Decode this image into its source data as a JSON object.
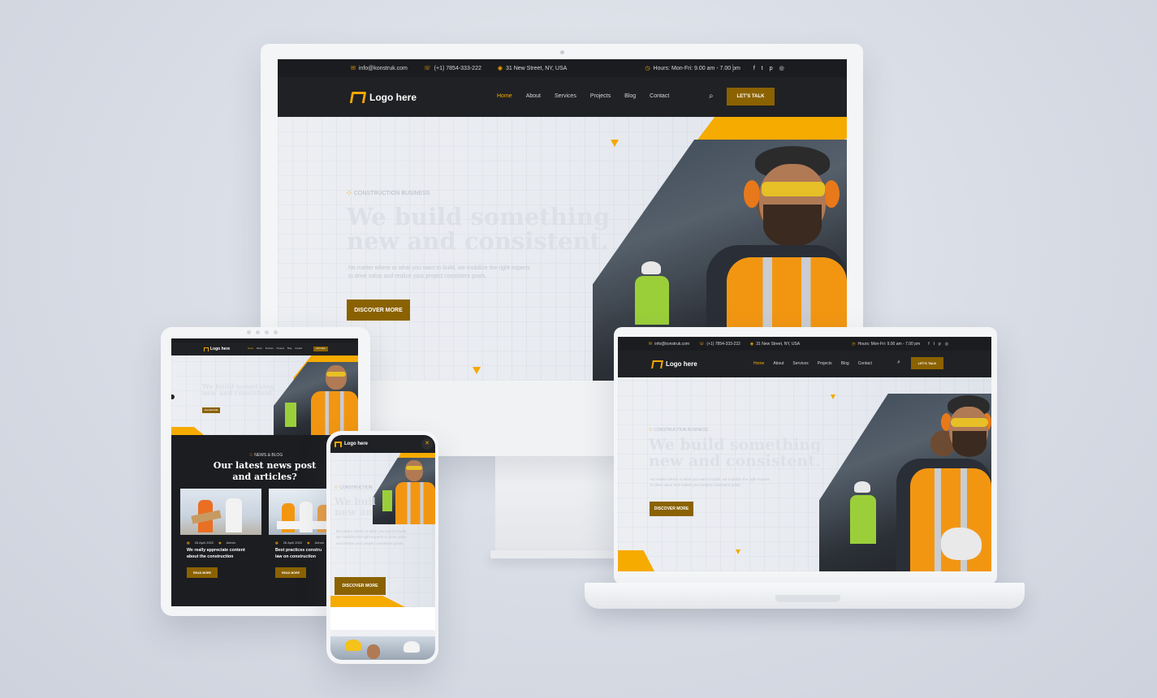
{
  "site": {
    "email": "info@konstruk.com",
    "phone": "(+1) 7854-333-222",
    "address": "31 New Street, NY, USA",
    "hours": "Hours: Mon-Fri: 9.00 am - 7.00 pm",
    "social_icons": [
      "facebook-icon",
      "twitter-icon",
      "pinterest-icon",
      "instagram-icon"
    ],
    "logo_text": "Logo here",
    "nav": [
      "Home",
      "About",
      "Services",
      "Projects",
      "Blog",
      "Contact"
    ],
    "active_nav": "Home",
    "cta_label": "LET'S TALK",
    "hero_tag": "CONSTRUCTION BUSINESS",
    "hero_title_line1": "We build something",
    "hero_title_line2": "new and consistent.",
    "hero_text_line1": "No matter where or what you want to build, we mobilize the right experts",
    "hero_text_line2": "to drive value and realize your project consistent goals.",
    "discover_label": "DISCOVER MORE",
    "accent_color": "#f6a800",
    "button_color": "#8b6200"
  },
  "tablet": {
    "news_tag": "NEWS & BLOG",
    "news_title_line1": "Our latest news post",
    "news_title_line2": "and articles?",
    "posts": [
      {
        "date": "26 April 2022",
        "author": "Admin",
        "title_line1": "We really appreciate content",
        "title_line2": "about the construction",
        "button": "READ MORE"
      },
      {
        "date": "26 April 2022",
        "author": "Admin",
        "title_line1": "Best practices constru",
        "title_line2": "law on construction",
        "button": "READ MORE"
      }
    ]
  },
  "phone": {
    "logo_text": "Logo here",
    "hero_tag": "CONSTRUCTION",
    "hero_title_line1": "We buil",
    "hero_title_line2": "new an",
    "hero_text_line1": "No matter where or what you want to build,",
    "hero_text_line2": "we mobilize the right experts to drive value",
    "hero_text_line3": "and realize your project consistent goals.",
    "discover_label": "DISCOVER MORE"
  }
}
